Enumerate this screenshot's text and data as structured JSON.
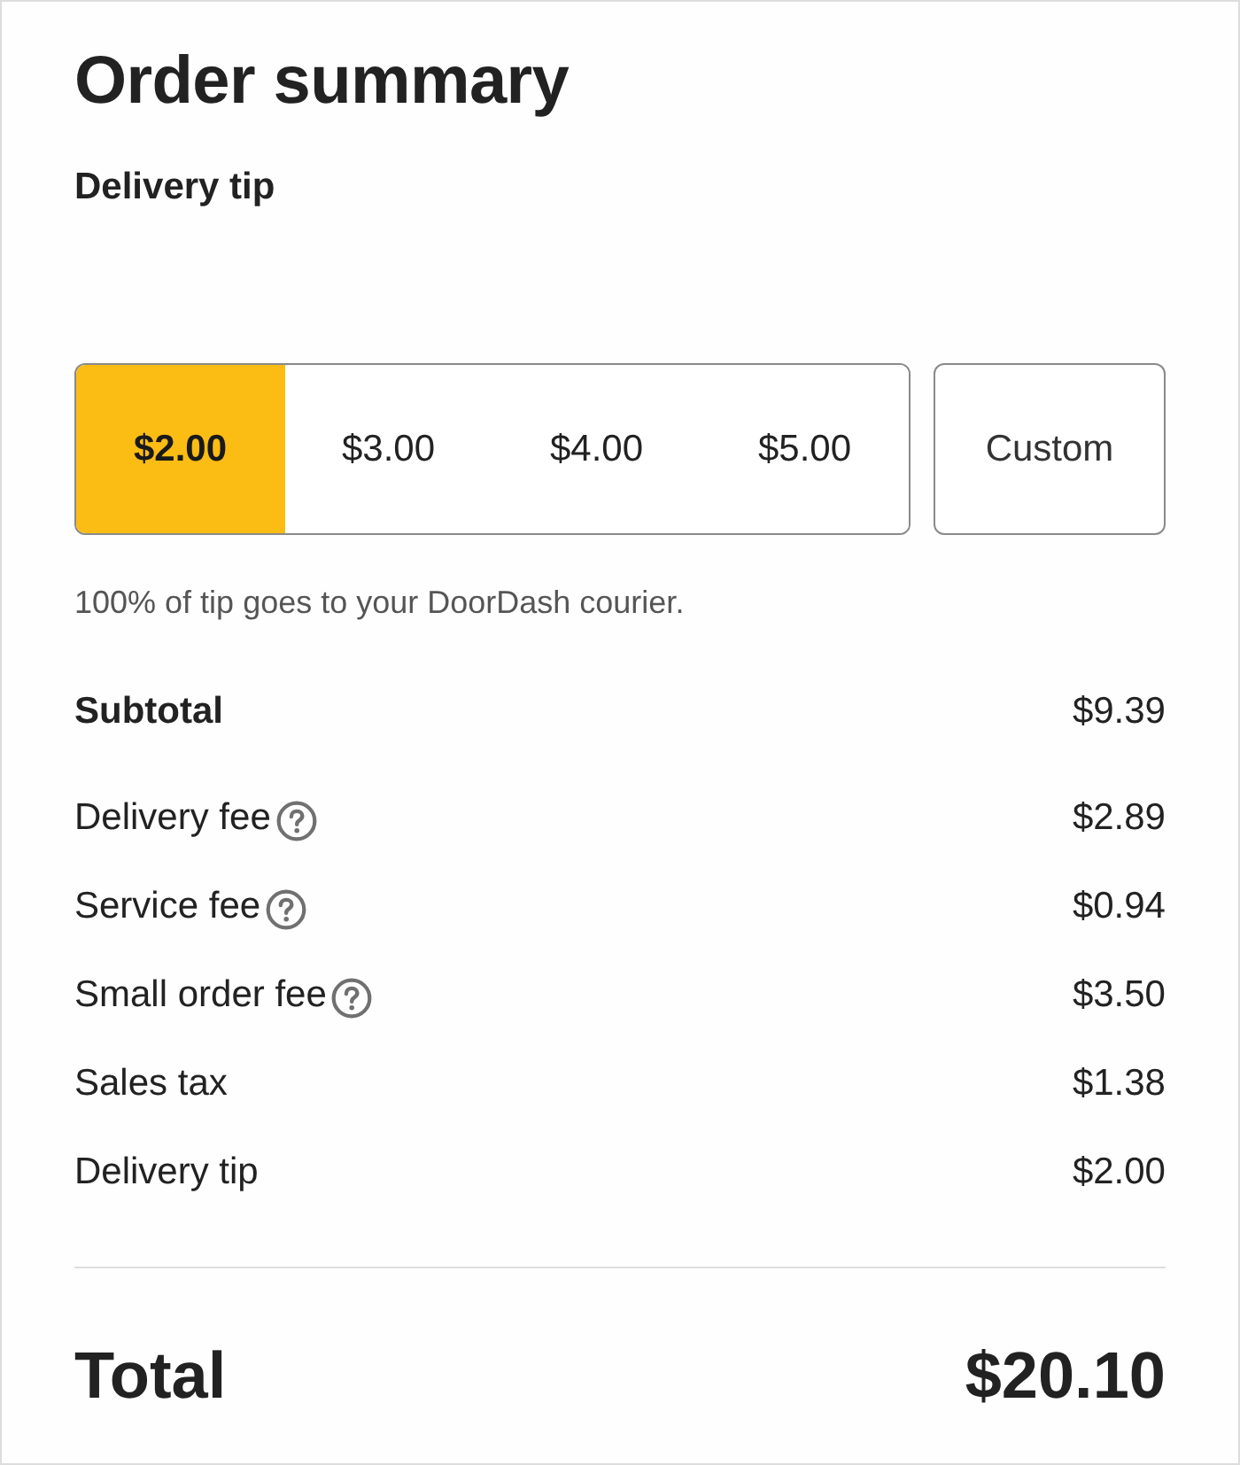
{
  "title": "Order summary",
  "tip_section": {
    "heading": "Delivery tip",
    "options": [
      {
        "label": "$2.00",
        "selected": true
      },
      {
        "label": "$3.00",
        "selected": false
      },
      {
        "label": "$4.00",
        "selected": false
      },
      {
        "label": "$5.00",
        "selected": false
      }
    ],
    "custom_button": "Custom",
    "note": "100% of tip goes to your DoorDash courier."
  },
  "lines": [
    {
      "kind": "subtotal",
      "label": "Subtotal",
      "help": false,
      "amount": "$9.39"
    },
    {
      "kind": "fee",
      "label": "Delivery fee",
      "help": true,
      "amount": "$2.89"
    },
    {
      "kind": "fee",
      "label": "Service fee",
      "help": true,
      "amount": "$0.94"
    },
    {
      "kind": "fee",
      "label": "Small order fee",
      "help": true,
      "amount": "$3.50"
    },
    {
      "kind": "fee",
      "label": "Sales tax",
      "help": false,
      "amount": "$1.38"
    },
    {
      "kind": "fee",
      "label": "Delivery tip",
      "help": false,
      "amount": "$2.00"
    }
  ],
  "total": {
    "label": "Total",
    "amount": "$20.10"
  }
}
